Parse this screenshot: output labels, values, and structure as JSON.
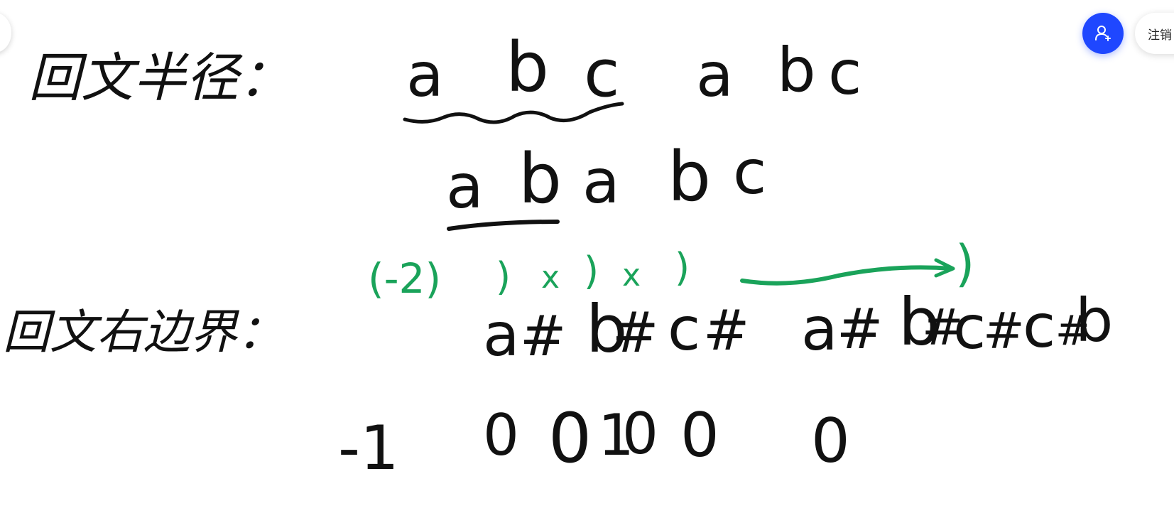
{
  "toolbar": {
    "logout_label": "注销",
    "invite_icon": "add-user-icon",
    "accent_color": "#1f47ff"
  },
  "whiteboard": {
    "ink_color": "#111111",
    "annotation_color": "#1aa35a",
    "heading_radius": "回文半径：",
    "heading_boundary": "回文右边界：",
    "example_string_1": [
      "a",
      "b",
      "c",
      "a",
      "b",
      "c"
    ],
    "example_string_2": [
      "a",
      "b",
      "a",
      "b",
      "c"
    ],
    "processed_string": [
      "a",
      "#",
      "b",
      "#",
      "c",
      "#",
      "a",
      "#",
      "b",
      "#",
      "c",
      "#",
      "c",
      "#",
      "b"
    ],
    "boundary_values": [
      "-1",
      "0",
      "0",
      "1",
      "0",
      "0",
      "0"
    ],
    "annotation_marks": [
      "(-2)",
      ")",
      "x",
      ")",
      "x",
      ")",
      ")"
    ]
  }
}
